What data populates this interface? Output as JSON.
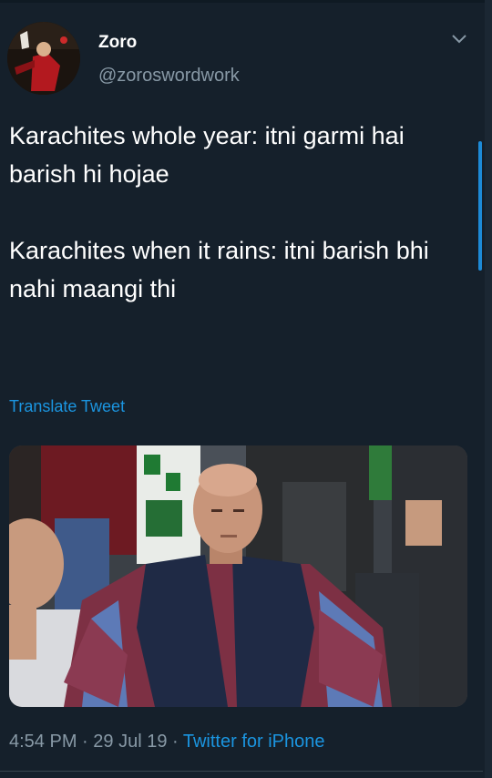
{
  "tweet": {
    "display_name": "Zoro",
    "handle": "@zoroswordwork",
    "text": "Karachites whole year:  itni garmi hai barish hi hojae\n\nKarachites when it rains: itni barish bhi nahi maangi thi",
    "translate_label": "Translate Tweet",
    "time": "4:54 PM",
    "date": "29 Jul 19",
    "separator": " · ",
    "source": "Twitter for iPhone"
  },
  "colors": {
    "background": "#15202b",
    "link": "#1b95e0",
    "muted": "#8899a6"
  }
}
